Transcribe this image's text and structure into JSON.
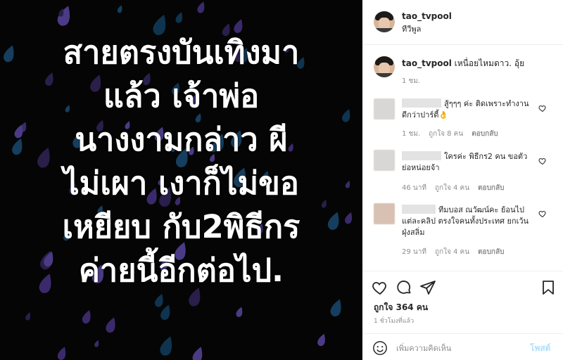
{
  "image": {
    "lines": [
      "สายตรงบันเทิงมา",
      "แล้ว เจ้าพ่อ",
      "นางงามกล่าว ผี",
      "ไม่เผา เงาก็ไม่ขอ",
      "เหยียบ กับ2พิธีกร",
      "ค่ายนี้อีกต่อไป."
    ],
    "background_color": "#050505",
    "drop_colors": [
      "#2a1e4a",
      "#3b2a6b",
      "#0f3450",
      "#163e5e",
      "#4b3b86"
    ]
  },
  "header": {
    "username": "tao_tvpool",
    "location": "ทีวีพูล"
  },
  "caption": {
    "username": "tao_tvpool",
    "text": "เหนื่อยไหมดาว. อุ้ย",
    "time": "1 ชม."
  },
  "comments": [
    {
      "text": "สู้ๆๆๆ ค่ะ ติดเพราะทำงาน ดีกว่าปาร์ตี้👌",
      "time": "1 ชม.",
      "likes": "ถูกใจ 8 คน",
      "reply": "ตอบกลับ"
    },
    {
      "text": "ใครค่ะ พิธีกร2 คน ขอตัวย่อหน่อยจ้า",
      "time": "46 นาที",
      "likes": "ถูกใจ 4 คน",
      "reply": "ตอบกลับ"
    },
    {
      "text": "ทีมบอส ณวัฒน์คะ ย้อนไปแต่ละคลิป ตรงใจคนทั้งประเทศ ยกเว้นฝุ่งสลิ่ม",
      "time": "29 นาที",
      "likes": "ถูกใจ 4 คน",
      "reply": "ตอบกลับ"
    }
  ],
  "actions": {
    "likes": "ถูกใจ 364 คน",
    "posted": "1 ชั่วโมงที่แล้ว",
    "comment_placeholder": "เพิ่มความคิดเห็น",
    "post_label": "โพสต์"
  }
}
